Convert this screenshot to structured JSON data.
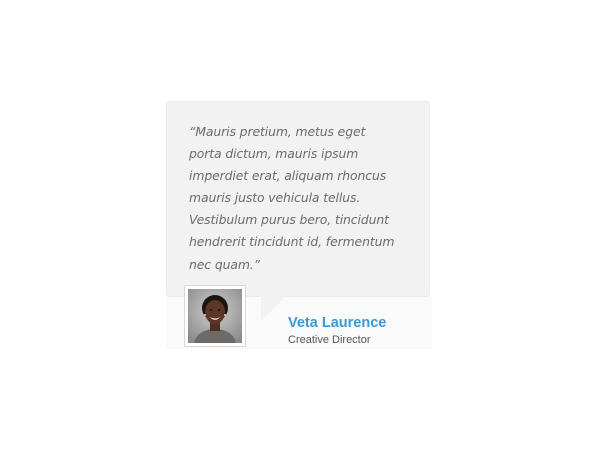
{
  "testimonial": {
    "quote": "“Mauris pretium, metus eget porta dictum, mauris ipsum imperdiet erat, aliquam rhoncus mauris justo vehicula tellus. Vestibulum purus bero, tincidunt hendrerit tincidunt id, fermentum nec quam.”",
    "author": {
      "name": "Veta Laurence",
      "role": "Creative Director",
      "avatar_icon": "person-photo"
    }
  },
  "colors": {
    "quote_box_bg": "#f2f2f2",
    "quote_text": "#6b6b6b",
    "author_name": "#3b9ad1",
    "author_role": "#555555"
  }
}
